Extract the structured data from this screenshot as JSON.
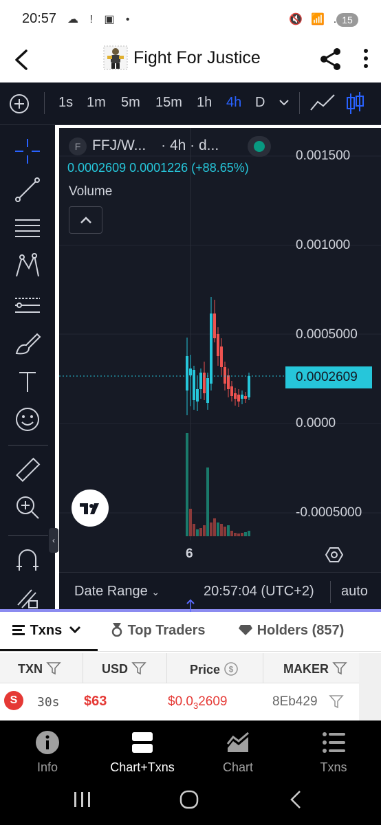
{
  "status_bar": {
    "time": "20:57",
    "left_icons": "☁ ! ▣ •",
    "right_icons": "🔇 📶 .ıl",
    "battery": "15"
  },
  "header": {
    "title": "Fight For Justice"
  },
  "toolbar": {
    "intervals": [
      "1s",
      "1m",
      "5m",
      "15m",
      "1h",
      "4h",
      "D"
    ],
    "active_interval": "4h"
  },
  "chart": {
    "symbol": "FFJ/W...",
    "interval_label": "· 4h · d...",
    "legend_exchange_letter": "F",
    "legend_values": "0.0002609  0.0001226 (+88.65%)",
    "volume_label": "Volume",
    "y_axis_labels": [
      "0.001500",
      "0.001000",
      "0.0005000",
      "0.0000",
      "-0.0005000"
    ],
    "current_price": "0.0002609",
    "x_axis_label": "6",
    "date_range": "Date Range",
    "clock": "20:57:04 (UTC+2)",
    "auto": "auto",
    "colors": {
      "up": "#26c6da",
      "down": "#ef5350",
      "background": "#161a25"
    }
  },
  "tabs": {
    "txns": "Txns",
    "top_traders": "Top Traders",
    "holders": "Holders (857)"
  },
  "table": {
    "headers": {
      "txn": "TXN",
      "usd": "USD",
      "price": "Price",
      "maker": "MAKER"
    },
    "rows": [
      {
        "side": "S",
        "age": "30s",
        "usd": "$63",
        "price_prefix": "$0.0",
        "price_sub": "3",
        "price_rest": "2609",
        "maker": "8Eb429"
      }
    ]
  },
  "bottom_nav": {
    "items": [
      "Info",
      "Chart+Txns",
      "Chart",
      "Txns"
    ],
    "active": "Chart+Txns"
  }
}
